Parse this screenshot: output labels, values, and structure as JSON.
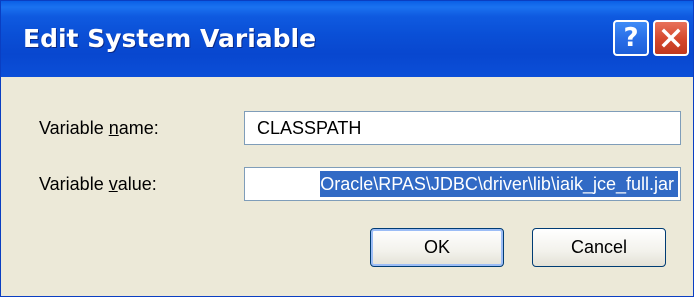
{
  "window": {
    "title": "Edit System Variable",
    "help_glyph": "?",
    "close_icon": "close-icon"
  },
  "form": {
    "name_label_pre": "Variable ",
    "name_label_accel": "n",
    "name_label_post": "ame:",
    "name_value": "CLASSPATH",
    "value_label_pre": "Variable ",
    "value_label_accel": "v",
    "value_label_post": "alue:",
    "value_value": "Oracle\\RPAS\\JDBC\\driver\\lib\\iaik_jce_full.jar"
  },
  "buttons": {
    "ok_label": "OK",
    "cancel_label": "Cancel"
  },
  "colors": {
    "title_bar": "#0a4fd6",
    "selection": "#316ac5",
    "close_button": "#d5472c",
    "dialog_face": "#ece9d8"
  }
}
